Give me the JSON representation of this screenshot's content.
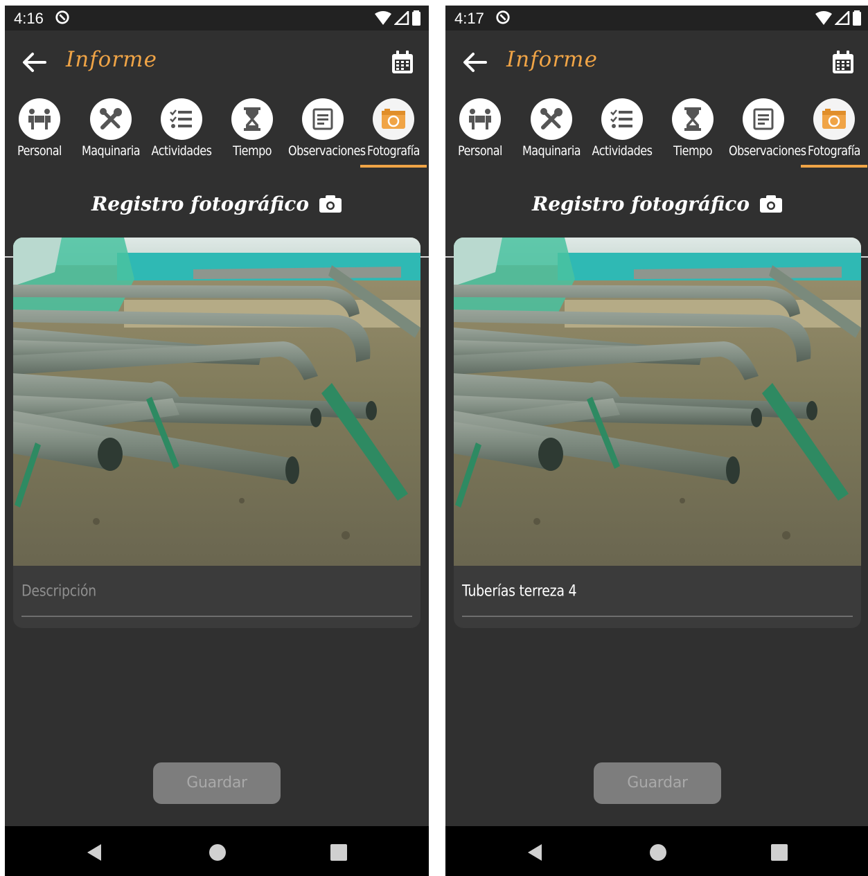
{
  "screens": [
    {
      "status_time": "4:16",
      "app_title": "Informe",
      "tabs": [
        {
          "label": "Personal",
          "icon": "people-carry-icon"
        },
        {
          "label": "Maquinaria",
          "icon": "tools-icon"
        },
        {
          "label": "Actividades",
          "icon": "checklist-icon"
        },
        {
          "label": "Tiempo",
          "icon": "hourglass-icon"
        },
        {
          "label": "Observaciones",
          "icon": "notes-icon"
        },
        {
          "label": "Fotografía",
          "icon": "photo-camera-icon"
        }
      ],
      "active_tab": "Fotografía",
      "section_title": "Registro fotográfico",
      "description": {
        "value": "",
        "placeholder": "Descripción"
      },
      "save_label": "Guardar"
    },
    {
      "status_time": "4:17",
      "app_title": "Informe",
      "tabs": [
        {
          "label": "Personal",
          "icon": "people-carry-icon"
        },
        {
          "label": "Maquinaria",
          "icon": "tools-icon"
        },
        {
          "label": "Actividades",
          "icon": "checklist-icon"
        },
        {
          "label": "Tiempo",
          "icon": "hourglass-icon"
        },
        {
          "label": "Observaciones",
          "icon": "notes-icon"
        },
        {
          "label": "Fotografía",
          "icon": "photo-camera-icon"
        }
      ],
      "active_tab": "Fotografía",
      "section_title": "Registro fotográfico",
      "description": {
        "value": "Tuberías terreza 4",
        "placeholder": "Descripción"
      },
      "save_label": "Guardar"
    }
  ],
  "colors": {
    "accent": "#f0a446",
    "background": "#303030",
    "status_bar": "#222222",
    "card": "#3b3b3b",
    "button_disabled": "#7d7d7d"
  }
}
